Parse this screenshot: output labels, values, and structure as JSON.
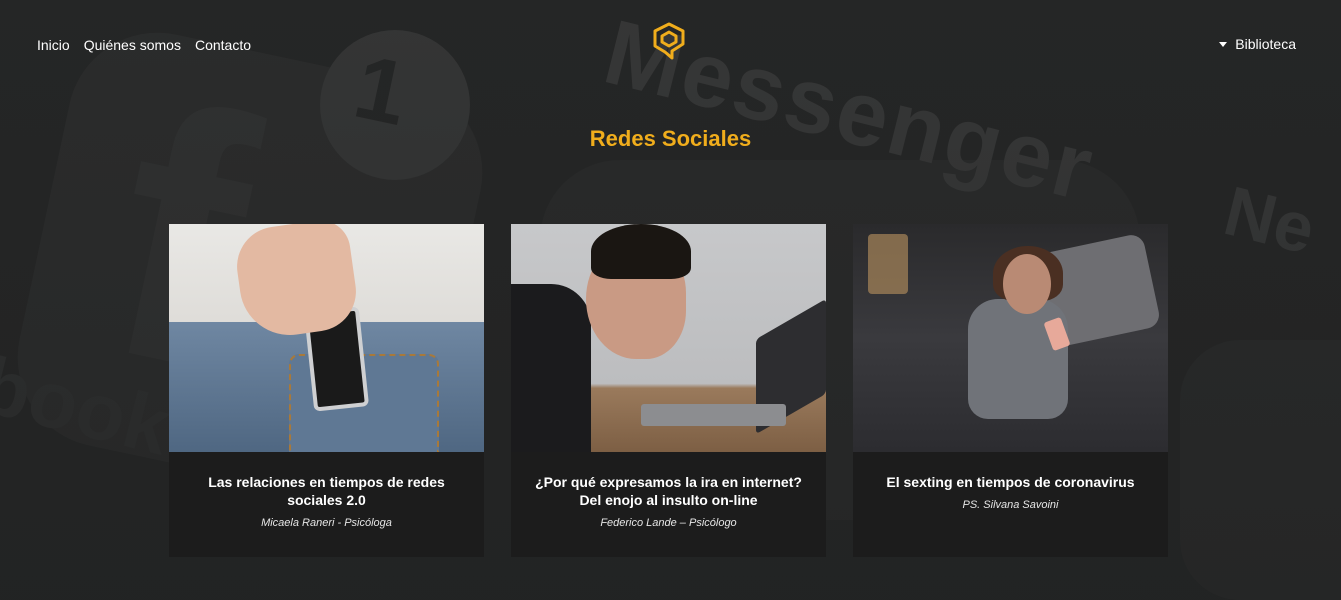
{
  "nav": {
    "items": [
      {
        "label": "Inicio"
      },
      {
        "label": "Quiénes somos"
      },
      {
        "label": "Contacto"
      }
    ],
    "right": {
      "label": "Biblioteca",
      "icon": "caret-down-icon"
    }
  },
  "logo": {
    "icon": "brand-logo-icon",
    "color": "#f0ad1c"
  },
  "section": {
    "title": "Redes Sociales",
    "accent": "#f0ad1c"
  },
  "cards": [
    {
      "title": "Las relaciones en tiempos de redes sociales 2.0",
      "author": "Micaela Raneri - Psicóloga"
    },
    {
      "title": "¿Por qué expresamos la ira en internet? Del enojo al insulto on-line",
      "author": "Federico Lande – Psicólogo"
    },
    {
      "title": "El sexting en tiempos de coronavirus",
      "author": "PS. Silvana Savoini"
    }
  ]
}
